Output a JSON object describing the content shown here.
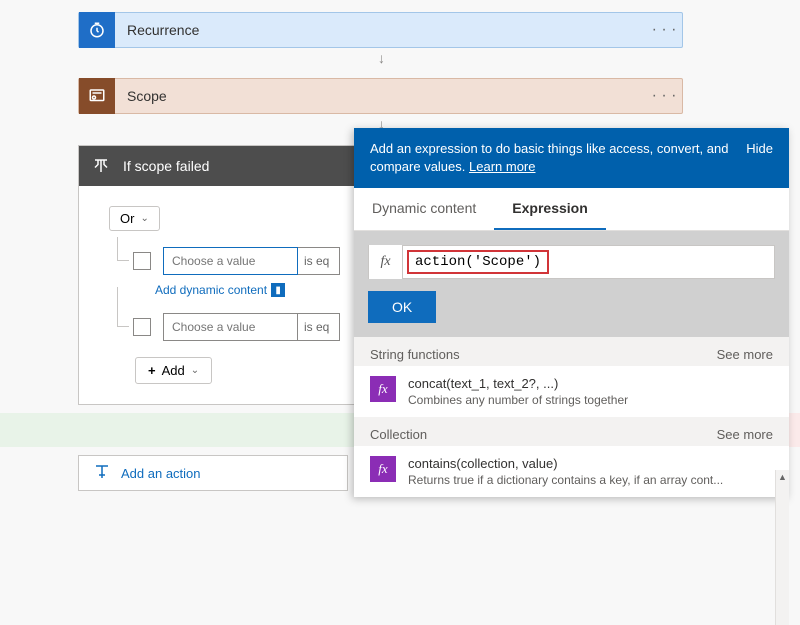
{
  "steps": {
    "recurrence": {
      "label": "Recurrence"
    },
    "scope": {
      "label": "Scope"
    }
  },
  "condition": {
    "title": "If scope failed",
    "logic": "Or",
    "value_placeholder": "Choose a value",
    "op_trunc": "is eq",
    "dyn_link": "Add dynamic content",
    "add_label": "Add"
  },
  "add_action": "Add an action",
  "panel": {
    "intro": "Add an expression to do basic things like access, convert, and compare values. ",
    "learn": "Learn more",
    "hide": "Hide",
    "tabs": {
      "dynamic": "Dynamic content",
      "expression": "Expression"
    },
    "fx_label": "fx",
    "expression_value": "action('Scope')",
    "ok": "OK",
    "sections": [
      {
        "title": "String functions",
        "see_more": "See more",
        "items": [
          {
            "sig": "concat(text_1, text_2?, ...)",
            "desc": "Combines any number of strings together"
          }
        ]
      },
      {
        "title": "Collection",
        "see_more": "See more",
        "items": [
          {
            "sig": "contains(collection, value)",
            "desc": "Returns true if a dictionary contains a key, if an array cont..."
          }
        ]
      }
    ]
  }
}
